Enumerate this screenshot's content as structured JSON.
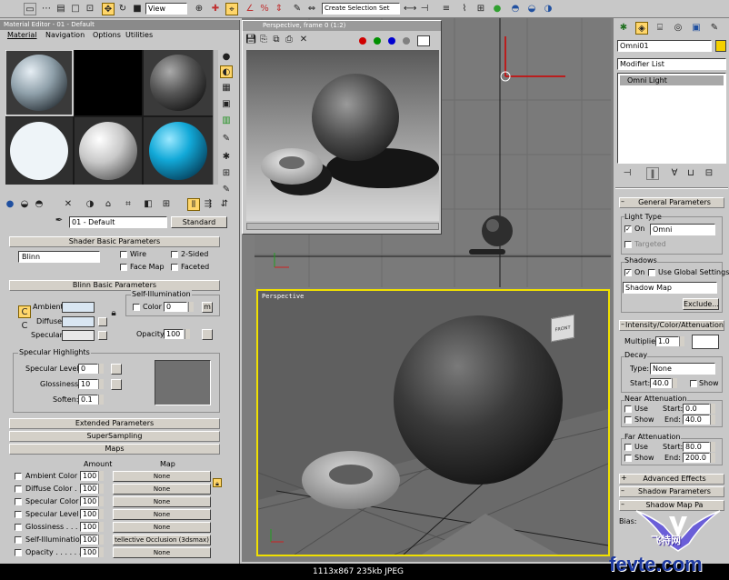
{
  "toolbar": {
    "view_select": "View",
    "selection_set_placeholder": "Create Selection Set"
  },
  "material_editor": {
    "title": "Material Editor - 01 - Default",
    "menus": [
      "Material",
      "Navigation",
      "Options",
      "Utilities"
    ],
    "material_name": "01 - Default",
    "material_type_button": "Standard",
    "shader_basic": {
      "rollout_title": "Shader Basic Parameters",
      "shader": "Blinn",
      "wire": "Wire",
      "two_sided": "2-Sided",
      "face_map": "Face Map",
      "faceted": "Faceted"
    },
    "blinn_basic": {
      "rollout_title": "Blinn Basic Parameters",
      "ambient": "Ambient:",
      "diffuse": "Diffuse:",
      "specular": "Specular:",
      "self_illum_title": "Self-Illumination",
      "color_label": "Color",
      "color_value": "0",
      "m_button": "m",
      "opacity_label": "Opacity:",
      "opacity_value": "100",
      "spec_highlights_title": "Specular Highlights",
      "spec_level_label": "Specular Level:",
      "spec_level_value": "0",
      "glossiness_label": "Glossiness:",
      "glossiness_value": "10",
      "soften_label": "Soften:",
      "soften_value": "0.1"
    },
    "collapsed_rollouts": [
      "Extended Parameters",
      "SuperSampling"
    ],
    "maps": {
      "rollout_title": "Maps",
      "col_amount": "Amount",
      "col_map": "Map",
      "rows": [
        {
          "label": "Ambient Color . . .",
          "amount": "100",
          "map": "None"
        },
        {
          "label": "Diffuse Color . . .",
          "amount": "100",
          "map": "None"
        },
        {
          "label": "Specular Color . .",
          "amount": "100",
          "map": "None"
        },
        {
          "label": "Specular Level . .",
          "amount": "100",
          "map": "None"
        },
        {
          "label": "Glossiness . . . . .",
          "amount": "100",
          "map": "None"
        },
        {
          "label": "Self-Illumination . .",
          "amount": "100",
          "map": "tellective Occlusion (3dsmax)"
        },
        {
          "label": "Opacity . . . . . .",
          "amount": "100",
          "map": "None"
        }
      ]
    }
  },
  "render_window": {
    "title": "Perspective, frame 0 (1:2)",
    "color_dots": [
      "#d00000",
      "#009000",
      "#0000d0",
      "#808080"
    ]
  },
  "viewport": {
    "label": "Perspective",
    "viewcube_label": "FRONT"
  },
  "command_panel": {
    "object_name": "Omni01",
    "modifier_list": "Modifier List",
    "stack_item": "Omni Light",
    "general": {
      "rollout_title": "General Parameters",
      "light_type_title": "Light Type",
      "on_label": "On",
      "light_type": "Omni",
      "targeted": "Targeted",
      "shadows_title": "Shadows",
      "shadows_on": "On",
      "use_global": "Use Global Settings",
      "shadow_type": "Shadow Map",
      "exclude_button": "Exclude..."
    },
    "intensity": {
      "rollout_title": "Intensity/Color/Attenuation",
      "multiplier_label": "Multiplier:",
      "multiplier_value": "1.0",
      "decay_title": "Decay",
      "type_label": "Type:",
      "type_value": "None",
      "start_label": "Start:",
      "start_value": "40.0",
      "show_label": "Show",
      "near_title": "Near Attenuation",
      "near_use": "Use",
      "near_show": "Show",
      "near_start_label": "Start:",
      "near_start_value": "0.0",
      "near_end_label": "End:",
      "near_end_value": "40.0",
      "far_title": "Far Attenuation",
      "far_use": "Use",
      "far_show": "Show",
      "far_start_label": "Start:",
      "far_start_value": "80.0",
      "far_end_label": "End:",
      "far_end_value": "200.0"
    },
    "advanced_effects": "Advanced Effects",
    "shadow_params": "Shadow Parameters",
    "shadow_map_params": "Shadow Map Pa",
    "bias_label": "Bias:"
  },
  "status_bar": {
    "text": "1113x867  235kb  JPEG"
  },
  "watermark": {
    "site": "fevte.com",
    "cn_name": "飞特网"
  }
}
